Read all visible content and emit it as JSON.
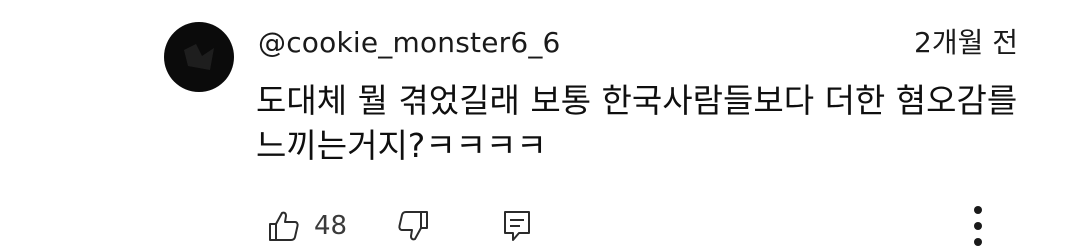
{
  "comment": {
    "author": "@cookie_monster6_6",
    "time": "2개월 전",
    "text": "도대체 뭘 겪었길래 보통 한국사람들보다 더한 혐오감를 느끼는거지?ㅋㅋㅋㅋ",
    "likes": "48",
    "avatar_color": "#0b0b0b"
  },
  "icons": {
    "like": "thumbs-up-icon",
    "dislike": "thumbs-down-icon",
    "reply": "reply-comment-icon",
    "more": "more-vertical-icon"
  }
}
